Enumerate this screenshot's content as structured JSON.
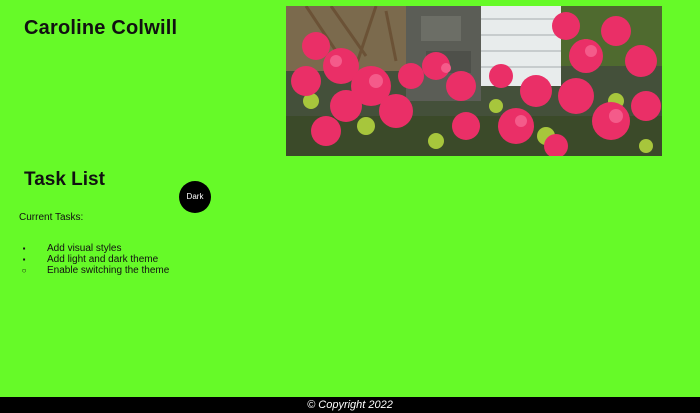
{
  "header": {
    "site_name": "Caroline Colwill"
  },
  "hero": {
    "image_description": "azalea-flowers-photo"
  },
  "tasks": {
    "title": "Task List",
    "theme_toggle_label": "Dark",
    "current_label": "Current Tasks:",
    "items": [
      {
        "text": "Add visual styles",
        "bullet": "▪"
      },
      {
        "text": "Add light and dark theme",
        "bullet": "▪"
      },
      {
        "text": "Enable switching the theme",
        "bullet": "○"
      }
    ]
  },
  "footer": {
    "copyright": "© Copyright 2022"
  },
  "colors": {
    "page_background": "#66fa28",
    "footer_background": "#000000",
    "toggle_background": "#000000",
    "flower_pink": "#ea2f67"
  }
}
